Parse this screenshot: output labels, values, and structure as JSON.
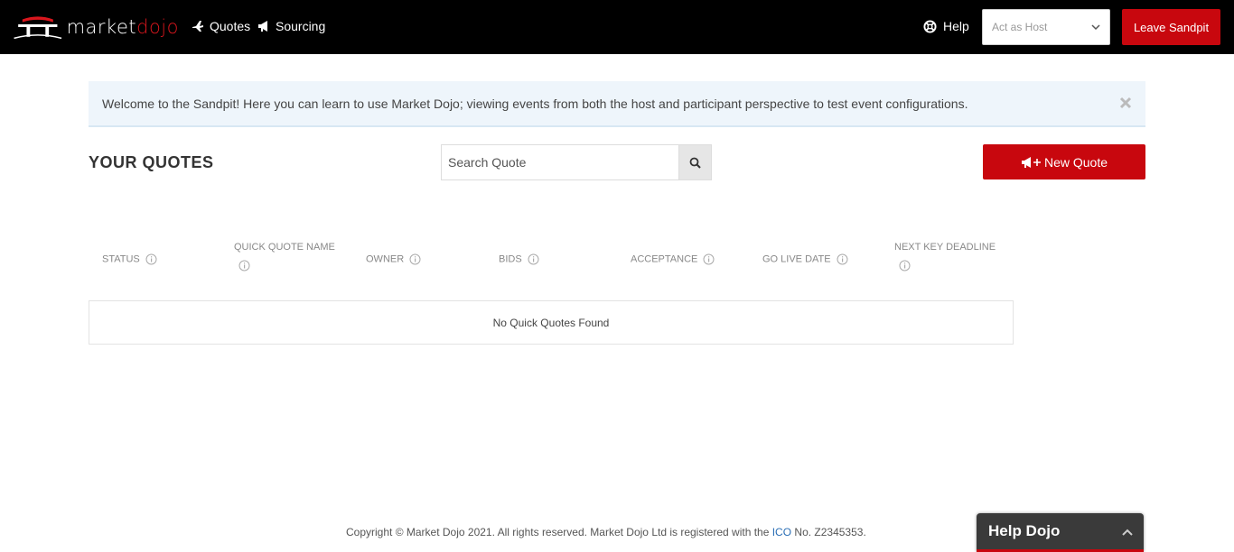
{
  "header": {
    "logo_market": "market",
    "logo_dojo": "dojo",
    "nav": {
      "quotes": "Quotes",
      "sourcing": "Sourcing"
    },
    "help": "Help",
    "act_as_select": "Act as Host",
    "leave_button": "Leave Sandpit"
  },
  "alert": {
    "message": "Welcome to the Sandpit! Here you can learn to use Market Dojo; viewing events from both the host and participant perspective to test event configurations."
  },
  "main": {
    "title": "YOUR QUOTES",
    "search_placeholder": "Search Quote",
    "new_quote_button": "New Quote",
    "table": {
      "columns": [
        "STATUS",
        "QUICK QUOTE NAME",
        "OWNER",
        "BIDS",
        "ACCEPTANCE",
        "GO LIVE DATE",
        "NEXT KEY DEADLINE"
      ],
      "empty_message": "No Quick Quotes Found"
    }
  },
  "footer": {
    "text_before": "Copyright © Market Dojo 2021. All rights reserved. Market Dojo Ltd is registered with the ",
    "link": "ICO",
    "text_after": " No. Z2345353."
  },
  "help_widget": {
    "label": "Help Dojo"
  },
  "colors": {
    "brand_red": "#c8070e",
    "topbar": "#000000",
    "alert_bg": "#eef5fb"
  }
}
